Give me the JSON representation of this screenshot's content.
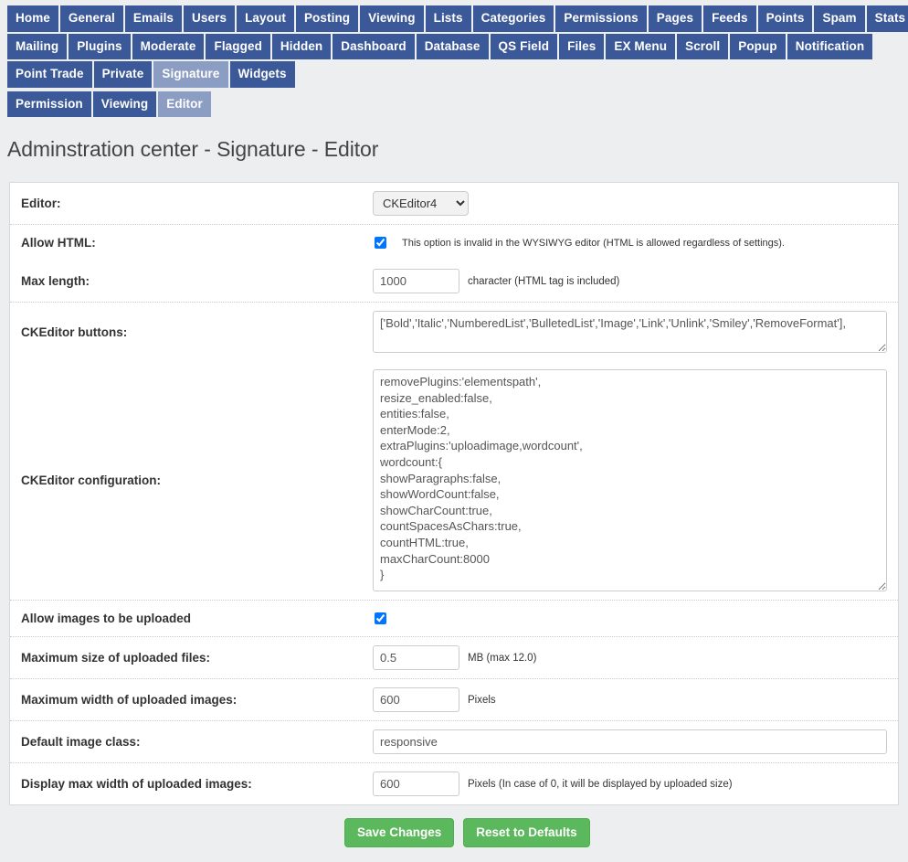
{
  "nav": {
    "rows": [
      [
        {
          "label": "Home",
          "active": false
        },
        {
          "label": "General",
          "active": false
        },
        {
          "label": "Emails",
          "active": false
        },
        {
          "label": "Users",
          "active": false
        },
        {
          "label": "Layout",
          "active": false
        },
        {
          "label": "Posting",
          "active": false
        },
        {
          "label": "Viewing",
          "active": false
        },
        {
          "label": "Lists",
          "active": false
        },
        {
          "label": "Categories",
          "active": false
        },
        {
          "label": "Permissions",
          "active": false
        },
        {
          "label": "Pages",
          "active": false
        },
        {
          "label": "Feeds",
          "active": false
        },
        {
          "label": "Points",
          "active": false
        },
        {
          "label": "Spam",
          "active": false
        },
        {
          "label": "Stats",
          "active": false
        }
      ],
      [
        {
          "label": "Mailing",
          "active": false
        },
        {
          "label": "Plugins",
          "active": false
        },
        {
          "label": "Moderate",
          "active": false
        },
        {
          "label": "Flagged",
          "active": false
        },
        {
          "label": "Hidden",
          "active": false
        },
        {
          "label": "Dashboard",
          "active": false
        },
        {
          "label": "Database",
          "active": false
        },
        {
          "label": "QS Field",
          "active": false
        },
        {
          "label": "Files",
          "active": false
        },
        {
          "label": "EX Menu",
          "active": false
        },
        {
          "label": "Scroll",
          "active": false
        },
        {
          "label": "Popup",
          "active": false
        },
        {
          "label": "Notification",
          "active": false
        }
      ],
      [
        {
          "label": "Point Trade",
          "active": false
        },
        {
          "label": "Private",
          "active": false
        },
        {
          "label": "Signature",
          "active": true
        },
        {
          "label": "Widgets",
          "active": false
        }
      ],
      [
        {
          "label": "Permission",
          "active": false
        },
        {
          "label": "Viewing",
          "active": false
        },
        {
          "label": "Editor",
          "active": true
        }
      ]
    ]
  },
  "page": {
    "title": "Adminstration center - Signature - Editor"
  },
  "form": {
    "editor": {
      "label": "Editor:",
      "value": "CKEditor4",
      "options": [
        "CKEditor4"
      ]
    },
    "allow_html": {
      "label": "Allow HTML:",
      "checked": true,
      "hint": "This option is invalid in the WYSIWYG editor (HTML is allowed regardless of settings)."
    },
    "max_length": {
      "label": "Max length:",
      "value": "1000",
      "hint": "character (HTML tag is included)"
    },
    "ckeditor_buttons": {
      "label": "CKEditor buttons:",
      "value": "['Bold','Italic','NumberedList','BulletedList','Image','Link','Unlink','Smiley','RemoveFormat'],"
    },
    "ckeditor_configuration": {
      "label": "CKEditor configuration:",
      "value": "removePlugins:'elementspath',\nresize_enabled:false,\nentities:false,\nenterMode:2,\nextraPlugins:'uploadimage,wordcount',\nwordcount:{\nshowParagraphs:false,\nshowWordCount:false,\nshowCharCount:true,\ncountSpacesAsChars:true,\ncountHTML:true,\nmaxCharCount:8000\n}"
    },
    "allow_image_upload": {
      "label": "Allow images to be uploaded",
      "checked": true
    },
    "max_file_size": {
      "label": "Maximum size of uploaded files:",
      "value": "0.5",
      "hint": "MB (max 12.0)"
    },
    "max_image_width": {
      "label": "Maximum width of uploaded images:",
      "value": "600",
      "hint": "Pixels"
    },
    "default_image_class": {
      "label": "Default image class:",
      "value": "responsive"
    },
    "display_max_width": {
      "label": "Display max width of uploaded images:",
      "value": "600",
      "hint": "Pixels (In case of 0, it will be displayed by uploaded size)"
    }
  },
  "footer": {
    "save_label": "Save Changes",
    "reset_label": "Reset to Defaults"
  },
  "colors": {
    "tab": "#3b5998",
    "tab_active": "#8b9dc3",
    "button_green": "#5cb85c",
    "page_background": "#eceef0"
  }
}
